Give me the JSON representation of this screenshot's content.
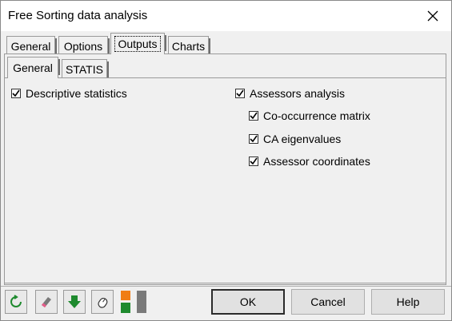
{
  "window": {
    "title": "Free Sorting data analysis"
  },
  "outer_tabs": [
    {
      "label": "General"
    },
    {
      "label": "Options"
    },
    {
      "label": "Outputs",
      "selected": true
    },
    {
      "label": "Charts"
    }
  ],
  "inner_tabs": [
    {
      "label": "General",
      "selected": true
    },
    {
      "label": "STATIS"
    }
  ],
  "options": {
    "descriptive_statistics": {
      "label": "Descriptive statistics",
      "checked": true
    },
    "assessors_analysis": {
      "label": "Assessors analysis",
      "checked": true
    },
    "co_occurrence_matrix": {
      "label": "Co-occurrence matrix",
      "checked": true
    },
    "ca_eigenvalues": {
      "label": "CA eigenvalues",
      "checked": true
    },
    "assessor_coordinates": {
      "label": "Assessor coordinates",
      "checked": true
    }
  },
  "buttons": {
    "ok": "OK",
    "cancel": "Cancel",
    "help": "Help"
  },
  "toolbar_icons": [
    "reset-icon",
    "eraser-icon",
    "download-arrow-icon",
    "mouse-icon",
    "color-toggle-icon"
  ],
  "colors": {
    "accent_green": "#1e8a2e",
    "accent_orange": "#f07d14"
  }
}
